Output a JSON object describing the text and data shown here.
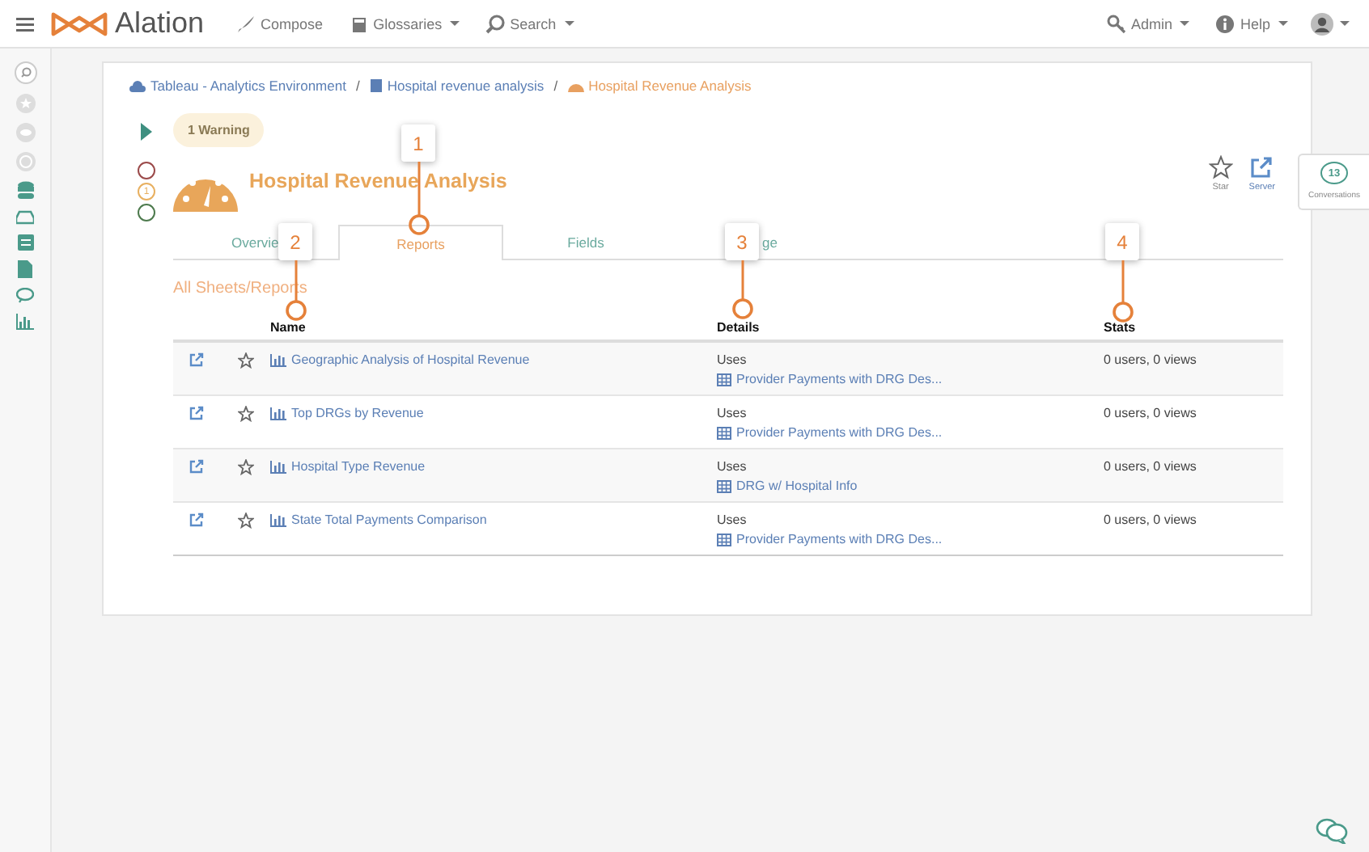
{
  "top_nav": {
    "brand": "Alation",
    "menu": [
      {
        "label": "Compose",
        "kind": "plain"
      },
      {
        "label": "Glossaries",
        "kind": "dropdown"
      },
      {
        "label": "Search",
        "kind": "dropdown"
      }
    ],
    "right": [
      {
        "label": "Admin",
        "kind": "dropdown"
      },
      {
        "label": "Help",
        "kind": "dropdown"
      }
    ]
  },
  "breadcrumb": [
    {
      "label": "Tableau - Analytics Environment",
      "selected": false
    },
    {
      "separator": "/",
      "label": "Hospital revenue analysis",
      "selected": false
    },
    {
      "separator": "/",
      "label": "Hospital Revenue Analysis",
      "selected": true
    }
  ],
  "warning": "1 Warning",
  "status_indicators": [
    {
      "color": "#9b4a4a"
    },
    {
      "color": "#e8b060",
      "count": "1"
    },
    {
      "color": "#4d7a4d"
    }
  ],
  "title": "Hospital Revenue Analysis",
  "actions": [
    {
      "label": "Star"
    },
    {
      "label": "Server"
    }
  ],
  "tabs": [
    {
      "label": "Overvie",
      "selected": false
    },
    {
      "label": "Reports",
      "selected": true
    },
    {
      "label": "Fields",
      "selected": false
    },
    {
      "label": "ge",
      "selected": false
    }
  ],
  "section_title": "All Sheets/Reports",
  "table": {
    "columns": [
      "Name",
      "Details",
      "Stats"
    ],
    "rows": [
      {
        "name": "Geographic Analysis of Hospital Revenue",
        "details_label": "Uses",
        "source": "Provider Payments with DRG Des...",
        "stats": "0 users, 0 views"
      },
      {
        "name": "Top DRGs by Revenue",
        "details_label": "Uses",
        "source": "Provider Payments with DRG Des...",
        "stats": "0 users, 0 views"
      },
      {
        "name": "Hospital Type Revenue",
        "details_label": "Uses",
        "source": "DRG w/ Hospital Info",
        "stats": "0 users, 0 views"
      },
      {
        "name": "State Total Payments Comparison",
        "details_label": "Uses",
        "source": "Provider Payments with DRG Des...",
        "stats": "0 users, 0 views"
      }
    ]
  },
  "conversations": {
    "count": "13",
    "label": "Conversations"
  },
  "callouts": [
    "1",
    "2",
    "3",
    "4"
  ]
}
